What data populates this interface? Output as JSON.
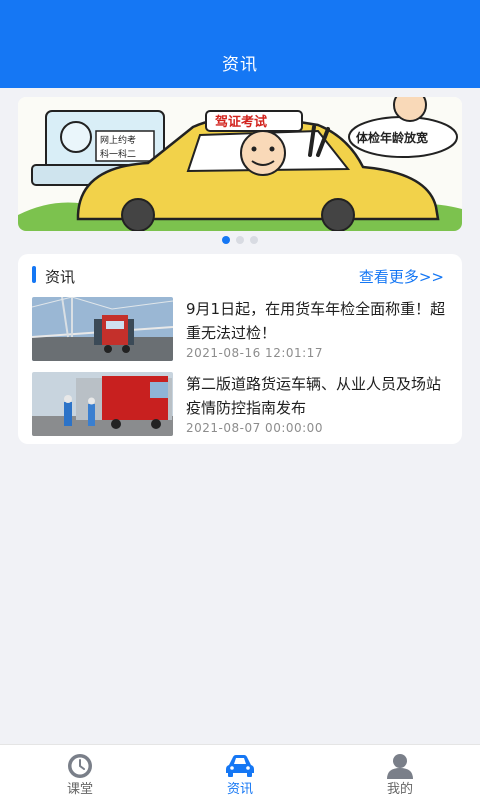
{
  "header": {
    "title": "资讯"
  },
  "banner": {
    "sign_text": "驾证考试",
    "screen_text_1": "网上约考",
    "screen_text_2": "科一科二",
    "bubble_text": "体检年龄放宽",
    "slide_count": 3,
    "active_slide": 1
  },
  "section": {
    "title": "资讯",
    "more_label": "查看更多>>"
  },
  "news": [
    {
      "title": "9月1日起，在用货车年检全面称重！超重无法过检！",
      "time": "2021-08-16 12:01:17",
      "thumb": "truck-on-bridge"
    },
    {
      "title": "第二版道路货运车辆、从业人员及场站疫情防控指南发布",
      "time": "2021-08-07 00:00:00",
      "thumb": "epidemic-checkpoint"
    }
  ],
  "tabs": [
    {
      "label": "课堂",
      "icon": "clock-icon",
      "active": false
    },
    {
      "label": "资讯",
      "icon": "car-icon",
      "active": true
    },
    {
      "label": "我的",
      "icon": "user-icon",
      "active": false
    }
  ],
  "colors": {
    "accent": "#1577f4",
    "background": "#f1f2f6"
  }
}
